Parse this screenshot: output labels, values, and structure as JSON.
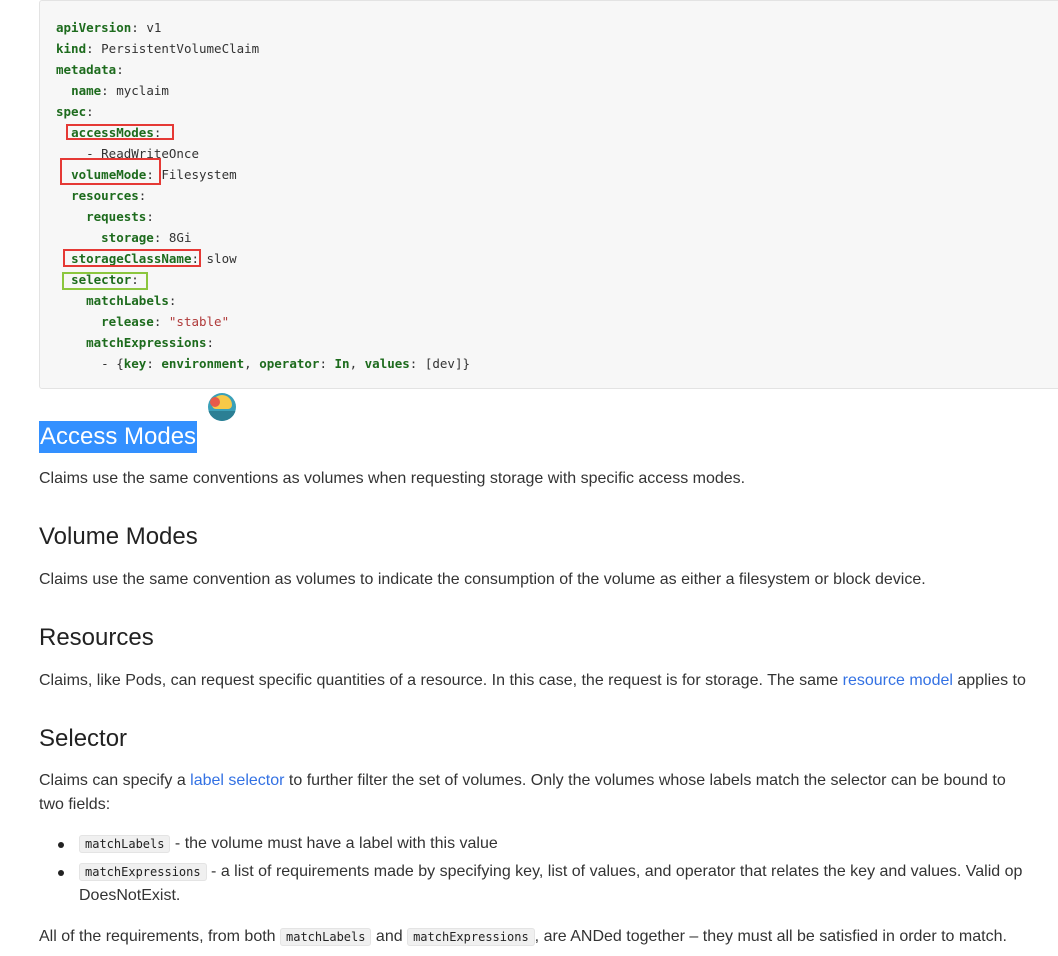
{
  "code": {
    "lines": [
      [
        {
          "t": "apiVersion",
          "c": "k"
        },
        {
          "t": ": v1",
          "c": "p"
        }
      ],
      [
        {
          "t": "kind",
          "c": "k"
        },
        {
          "t": ": PersistentVolumeClaim",
          "c": "p"
        }
      ],
      [
        {
          "t": "metadata",
          "c": "k"
        },
        {
          "t": ":",
          "c": "p"
        }
      ],
      [
        {
          "t": "  ",
          "c": "p"
        },
        {
          "t": "name",
          "c": "k"
        },
        {
          "t": ": myclaim",
          "c": "p"
        }
      ],
      [
        {
          "t": "spec",
          "c": "k"
        },
        {
          "t": ":",
          "c": "p"
        }
      ],
      [
        {
          "t": "  ",
          "c": "p"
        },
        {
          "t": "accessModes",
          "c": "k"
        },
        {
          "t": ":",
          "c": "p"
        }
      ],
      [
        {
          "t": "    - ReadWriteOnce",
          "c": "p"
        }
      ],
      [
        {
          "t": "  ",
          "c": "p"
        },
        {
          "t": "volumeMode",
          "c": "k"
        },
        {
          "t": ": Filesystem",
          "c": "p"
        }
      ],
      [
        {
          "t": "  ",
          "c": "p"
        },
        {
          "t": "resources",
          "c": "k"
        },
        {
          "t": ":",
          "c": "p"
        }
      ],
      [
        {
          "t": "    ",
          "c": "p"
        },
        {
          "t": "requests",
          "c": "k"
        },
        {
          "t": ":",
          "c": "p"
        }
      ],
      [
        {
          "t": "      ",
          "c": "p"
        },
        {
          "t": "storage",
          "c": "k"
        },
        {
          "t": ": 8Gi",
          "c": "p"
        }
      ],
      [
        {
          "t": "  ",
          "c": "p"
        },
        {
          "t": "storageClassName",
          "c": "k"
        },
        {
          "t": ": slow",
          "c": "p"
        }
      ],
      [
        {
          "t": "  ",
          "c": "p"
        },
        {
          "t": "selector",
          "c": "k"
        },
        {
          "t": ":",
          "c": "p"
        }
      ],
      [
        {
          "t": "    ",
          "c": "p"
        },
        {
          "t": "matchLabels",
          "c": "k"
        },
        {
          "t": ":",
          "c": "p"
        }
      ],
      [
        {
          "t": "      ",
          "c": "p"
        },
        {
          "t": "release",
          "c": "k"
        },
        {
          "t": ": ",
          "c": "p"
        },
        {
          "t": "\"stable\"",
          "c": "s"
        }
      ],
      [
        {
          "t": "    ",
          "c": "p"
        },
        {
          "t": "matchExpressions",
          "c": "k"
        },
        {
          "t": ":",
          "c": "p"
        }
      ],
      [
        {
          "t": "      - {",
          "c": "p"
        },
        {
          "t": "key",
          "c": "k"
        },
        {
          "t": ": ",
          "c": "p"
        },
        {
          "t": "environment",
          "c": "k"
        },
        {
          "t": ", ",
          "c": "p"
        },
        {
          "t": "operator",
          "c": "k"
        },
        {
          "t": ": ",
          "c": "p"
        },
        {
          "t": "In",
          "c": "k"
        },
        {
          "t": ", ",
          "c": "p"
        },
        {
          "t": "values",
          "c": "k"
        },
        {
          "t": ": [dev]}",
          "c": "p"
        }
      ]
    ]
  },
  "sections": {
    "access_modes": {
      "title": "Access Modes",
      "text": "Claims use the same conventions as volumes when requesting storage with specific access modes."
    },
    "volume_modes": {
      "title": "Volume Modes",
      "text": "Claims use the same convention as volumes to indicate the consumption of the volume as either a filesystem or block device."
    },
    "resources": {
      "title": "Resources",
      "text_before": "Claims, like Pods, can request specific quantities of a resource. In this case, the request is for storage. The same ",
      "link": "resource model",
      "text_after": " applies to"
    },
    "selector": {
      "title": "Selector",
      "text_before": "Claims can specify a ",
      "link": "label selector",
      "text_after": " to further filter the set of volumes. Only the volumes whose labels match the selector can be bound to",
      "text_line2": "two fields:",
      "bullets": [
        {
          "code": "matchLabels",
          "text": " - the volume must have a label with this value"
        },
        {
          "code": "matchExpressions",
          "text": " - a list of requirements made by specifying key, list of values, and operator that relates the key and values. Valid op",
          "text_line2": "DoesNotExist."
        }
      ],
      "footer_before": "All of the requirements, from both ",
      "footer_code1": "matchLabels",
      "footer_mid": " and ",
      "footer_code2": "matchExpressions",
      "footer_after": ", are ANDed together – they must all be satisfied in order to match."
    }
  }
}
